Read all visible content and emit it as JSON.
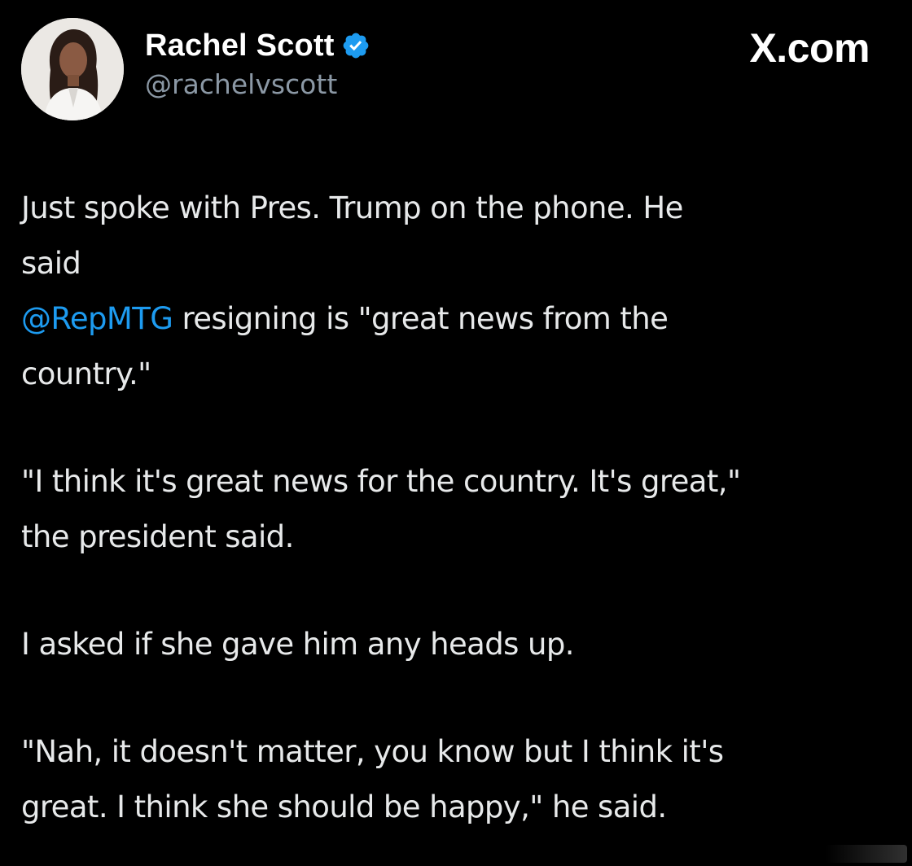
{
  "header": {
    "author_name": "Rachel Scott",
    "author_handle": "@rachelvscott",
    "source_logo": "X.com",
    "verified": true,
    "avatar_icon": "avatar",
    "verified_icon": "verified-badge-icon"
  },
  "tweet": {
    "line1": "Just spoke with Pres. Trump on the phone. He",
    "line2": "said",
    "mention": "@RepMTG",
    "line3_rest": " resigning is \"great news from the",
    "line4": "country.\"",
    "line5": "\"I think it's great news for the country. It's great,\"",
    "line6": "the president said.",
    "line7": "I asked if she gave him any heads up.",
    "line8": "\"Nah, it doesn't matter, you know but I think it's",
    "line9": "great. I think she should be happy,\" he said."
  },
  "colors": {
    "background": "#000000",
    "text": "#e7e9ea",
    "handle": "#8b98a5",
    "mention": "#1d9bf0",
    "verified_badge": "#1d9bf0"
  }
}
